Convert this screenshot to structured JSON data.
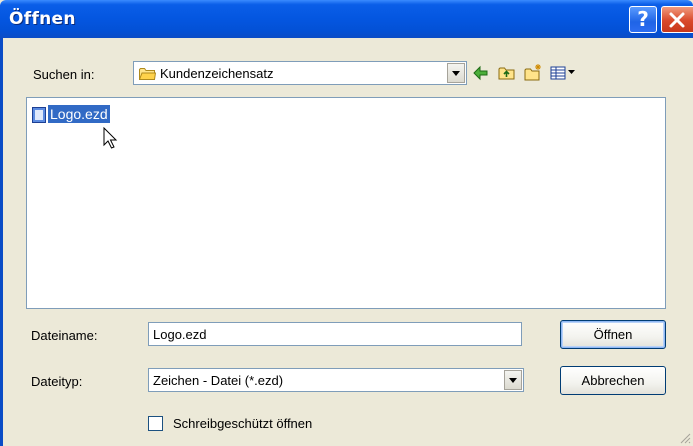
{
  "window": {
    "title": "Öffnen",
    "help_button": "?",
    "close_icon": "close-icon"
  },
  "lookin": {
    "label": "Suchen in:",
    "value": "Kundenzeichensatz",
    "icon": "folder-icon"
  },
  "toolbar": {
    "icons": [
      "back-arrow-icon",
      "up-folder-icon",
      "new-folder-icon",
      "view-menu-icon"
    ]
  },
  "files": [
    {
      "name": "Logo.ezd",
      "icon": "document-icon",
      "selected": true
    }
  ],
  "filename": {
    "label": "Dateiname:",
    "value": "Logo.ezd"
  },
  "filetype": {
    "label": "Dateityp:",
    "value": "Zeichen - Datei (*.ezd)"
  },
  "buttons": {
    "open": "Öffnen",
    "cancel": "Abbrechen"
  },
  "readonly": {
    "label": "Schreibgeschützt öffnen",
    "checked": false
  },
  "colors": {
    "titlebar": "#0456e0",
    "dialog_bg": "#ece9d8",
    "selection": "#316ac5",
    "close_button": "#d9492a"
  }
}
